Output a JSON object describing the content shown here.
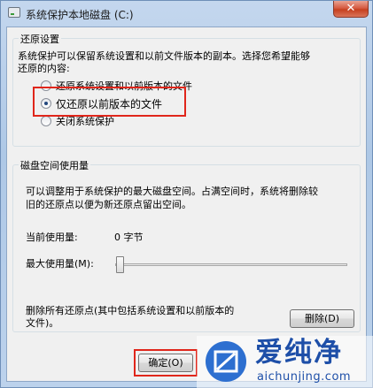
{
  "window": {
    "title": "系统保护本地磁盘 (C:)",
    "close_glyph": "✕"
  },
  "restore_settings": {
    "group_title": "还原设置",
    "description_line1": "系统保护可以保留系统设置和以前文件版本的副本。选择您希望能够",
    "description_line2": "还原的内容:",
    "options": [
      {
        "label": "还原系统设置和以前版本的文件",
        "checked": false
      },
      {
        "label": "仅还原以前版本的文件",
        "checked": true
      },
      {
        "label": "关闭系统保护",
        "checked": false
      }
    ]
  },
  "disk_usage": {
    "group_title": "磁盘空间使用量",
    "description_line1": "可以调整用于系统保护的最大磁盘空间。占满空间时，系统将删除较",
    "description_line2": "旧的还原点以便为新还原点留出空间。",
    "current_usage_label": "当前使用量:",
    "current_usage_value": "0 字节",
    "max_usage_label": "最大使用量(M):",
    "max_usage_percent": 0,
    "delete_description_line1": "删除所有还原点(其中包括系统设置和以前版本的",
    "delete_description_line2": "文件)。",
    "delete_button_label": "删除(D)"
  },
  "footer": {
    "ok_button_label": "确定(O)"
  },
  "watermark": {
    "title": "爱纯净",
    "url": "aichunjing.com"
  },
  "icons": {
    "app": "drive-icon",
    "close": "close-icon",
    "watermark_logo": "aichunjing-logo-icon"
  },
  "colors": {
    "highlight_box": "#e0261b",
    "watermark": "#1e4fa8"
  }
}
